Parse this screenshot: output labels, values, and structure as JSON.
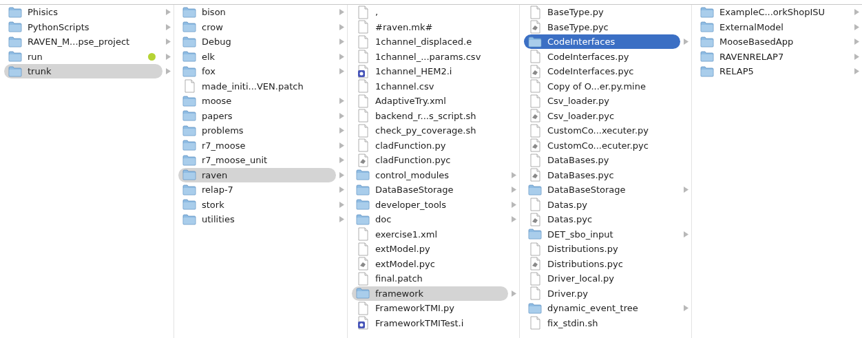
{
  "columns": [
    {
      "items": [
        {
          "name": "Phisics",
          "kind": "folder",
          "selected": false
        },
        {
          "name": "PythonScripts",
          "kind": "folder",
          "selected": false
        },
        {
          "name": "RAVEN_M...pse_project",
          "kind": "folder",
          "selected": false
        },
        {
          "name": "run",
          "kind": "folder",
          "selected": false,
          "color": "#b5d334"
        },
        {
          "name": "trunk",
          "kind": "folder",
          "selected": true,
          "focused": false
        }
      ]
    },
    {
      "items": [
        {
          "name": "bison",
          "kind": "folder",
          "selected": false
        },
        {
          "name": "crow",
          "kind": "folder",
          "selected": false
        },
        {
          "name": "Debug",
          "kind": "folder",
          "selected": false
        },
        {
          "name": "elk",
          "kind": "folder",
          "selected": false
        },
        {
          "name": "fox",
          "kind": "folder",
          "selected": false
        },
        {
          "name": "made_initi...VEN.patch",
          "kind": "file",
          "selected": false
        },
        {
          "name": "moose",
          "kind": "folder",
          "selected": false
        },
        {
          "name": "papers",
          "kind": "folder",
          "selected": false
        },
        {
          "name": "problems",
          "kind": "folder",
          "selected": false
        },
        {
          "name": "r7_moose",
          "kind": "folder",
          "selected": false
        },
        {
          "name": "r7_moose_unit",
          "kind": "folder",
          "selected": false
        },
        {
          "name": "raven",
          "kind": "folder",
          "selected": true,
          "focused": false
        },
        {
          "name": "relap-7",
          "kind": "folder",
          "selected": false
        },
        {
          "name": "stork",
          "kind": "folder",
          "selected": false
        },
        {
          "name": "utilities",
          "kind": "folder",
          "selected": false
        }
      ]
    },
    {
      "items": [
        {
          "name": ",",
          "kind": "file",
          "selected": false
        },
        {
          "name": "#raven.mk#",
          "kind": "file",
          "selected": false
        },
        {
          "name": "1channel_displaced.e",
          "kind": "file",
          "selected": false
        },
        {
          "name": "1channel_...params.csv",
          "kind": "file",
          "selected": false
        },
        {
          "name": "1channel_HEM2.i",
          "kind": "source",
          "selected": false
        },
        {
          "name": "1channel.csv",
          "kind": "file",
          "selected": false
        },
        {
          "name": "AdaptiveTry.xml",
          "kind": "file",
          "selected": false
        },
        {
          "name": "backend_r...s_script.sh",
          "kind": "file",
          "selected": false
        },
        {
          "name": "check_py_coverage.sh",
          "kind": "file",
          "selected": false
        },
        {
          "name": "cladFunction.py",
          "kind": "file",
          "selected": false
        },
        {
          "name": "cladFunction.pyc",
          "kind": "compiled",
          "selected": false
        },
        {
          "name": "control_modules",
          "kind": "folder",
          "selected": false
        },
        {
          "name": "DataBaseStorage",
          "kind": "folder",
          "selected": false
        },
        {
          "name": "developer_tools",
          "kind": "folder",
          "selected": false
        },
        {
          "name": "doc",
          "kind": "folder",
          "selected": false
        },
        {
          "name": "exercise1.xml",
          "kind": "file",
          "selected": false
        },
        {
          "name": "extModel.py",
          "kind": "file",
          "selected": false
        },
        {
          "name": "extModel.pyc",
          "kind": "compiled",
          "selected": false
        },
        {
          "name": "final.patch",
          "kind": "file",
          "selected": false
        },
        {
          "name": "framework",
          "kind": "folder",
          "selected": true,
          "focused": false
        },
        {
          "name": "FrameworkTMI.py",
          "kind": "file",
          "selected": false
        },
        {
          "name": "FrameworkTMITest.i",
          "kind": "source",
          "selected": false
        }
      ]
    },
    {
      "items": [
        {
          "name": "BaseType.py",
          "kind": "file",
          "selected": false
        },
        {
          "name": "BaseType.pyc",
          "kind": "compiled",
          "selected": false
        },
        {
          "name": "CodeInterfaces",
          "kind": "folder",
          "selected": true,
          "focused": true
        },
        {
          "name": "CodeInterfaces.py",
          "kind": "file",
          "selected": false
        },
        {
          "name": "CodeInterfaces.pyc",
          "kind": "compiled",
          "selected": false
        },
        {
          "name": "Copy of O...er.py.mine",
          "kind": "file",
          "selected": false
        },
        {
          "name": "Csv_loader.py",
          "kind": "file",
          "selected": false
        },
        {
          "name": "Csv_loader.pyc",
          "kind": "compiled",
          "selected": false
        },
        {
          "name": "CustomCo...xecuter.py",
          "kind": "file",
          "selected": false
        },
        {
          "name": "CustomCo...ecuter.pyc",
          "kind": "compiled",
          "selected": false
        },
        {
          "name": "DataBases.py",
          "kind": "file",
          "selected": false
        },
        {
          "name": "DataBases.pyc",
          "kind": "compiled",
          "selected": false
        },
        {
          "name": "DataBaseStorage",
          "kind": "folder",
          "selected": false
        },
        {
          "name": "Datas.py",
          "kind": "file",
          "selected": false
        },
        {
          "name": "Datas.pyc",
          "kind": "compiled",
          "selected": false
        },
        {
          "name": "DET_sbo_input",
          "kind": "folder",
          "selected": false
        },
        {
          "name": "Distributions.py",
          "kind": "file",
          "selected": false
        },
        {
          "name": "Distributions.pyc",
          "kind": "compiled",
          "selected": false
        },
        {
          "name": "Driver_local.py",
          "kind": "file",
          "selected": false
        },
        {
          "name": "Driver.py",
          "kind": "file",
          "selected": false
        },
        {
          "name": "dynamic_event_tree",
          "kind": "folder",
          "selected": false
        },
        {
          "name": "fix_stdin.sh",
          "kind": "file",
          "selected": false
        }
      ]
    },
    {
      "items": [
        {
          "name": "ExampleC...orkShopISU",
          "kind": "folder",
          "selected": false
        },
        {
          "name": "ExternalModel",
          "kind": "folder",
          "selected": false
        },
        {
          "name": "MooseBasedApp",
          "kind": "folder",
          "selected": false
        },
        {
          "name": "RAVENRELAP7",
          "kind": "folder",
          "selected": false
        },
        {
          "name": "RELAP5",
          "kind": "folder",
          "selected": false
        }
      ]
    }
  ]
}
